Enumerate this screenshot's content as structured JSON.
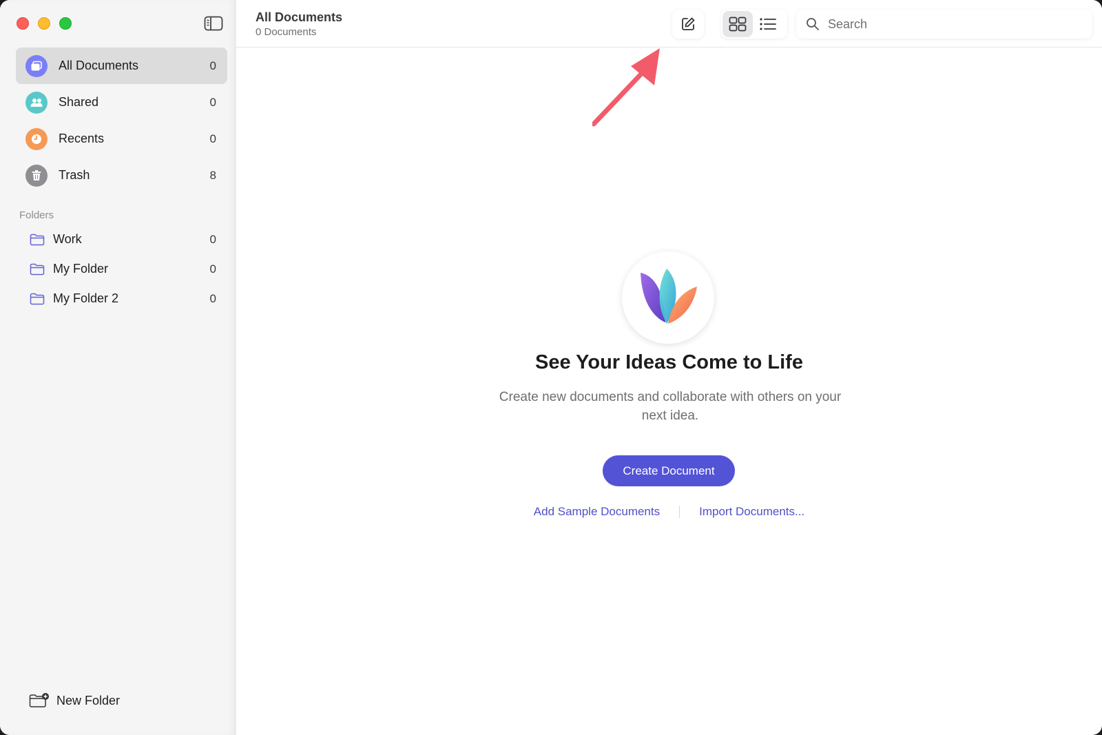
{
  "sidebar": {
    "nav": [
      {
        "label": "All Documents",
        "count": "0",
        "icon": "documents-icon",
        "color": "#7b7ff5"
      },
      {
        "label": "Shared",
        "count": "0",
        "icon": "people-icon",
        "color": "#5ac8c8"
      },
      {
        "label": "Recents",
        "count": "0",
        "icon": "clock-icon",
        "color": "#f59a55"
      },
      {
        "label": "Trash",
        "count": "8",
        "icon": "trash-icon",
        "color": "#8e8e93"
      }
    ],
    "folders_header": "Folders",
    "folders": [
      {
        "label": "Work",
        "count": "0"
      },
      {
        "label": "My Folder",
        "count": "0"
      },
      {
        "label": "My Folder 2",
        "count": "0"
      }
    ],
    "new_folder": "New Folder"
  },
  "toolbar": {
    "title": "All Documents",
    "subtitle": "0 Documents",
    "search_placeholder": "Search"
  },
  "empty_state": {
    "title": "See Your Ideas Come to Life",
    "description": "Create new documents and collaborate with others on your next idea.",
    "create_button": "Create Document",
    "add_sample": "Add Sample Documents",
    "import": "Import Documents..."
  },
  "colors": {
    "accent": "#5353d6",
    "link": "#5050c8",
    "annotation_arrow": "#f25c6a"
  }
}
